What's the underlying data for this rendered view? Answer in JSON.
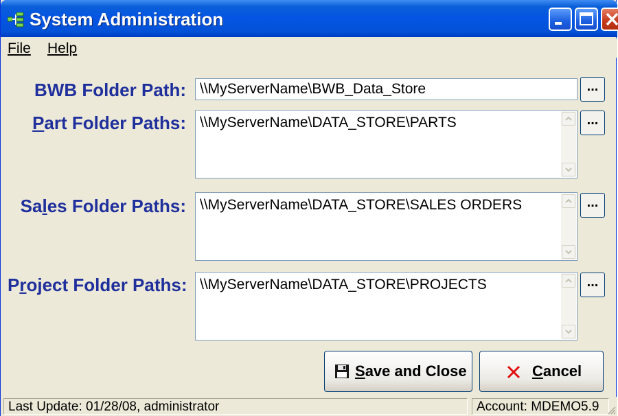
{
  "window": {
    "title": "System Administration"
  },
  "menu": {
    "file": "File",
    "help": "Help"
  },
  "fields": {
    "bwb": {
      "label_pre": "BWB Folder Path:",
      "value": "\\\\MyServerName\\BWB_Data_Store"
    },
    "part": {
      "label_ul": "P",
      "label_rest": "art Folder Paths:",
      "value": "\\\\MyServerName\\DATA_STORE\\PARTS"
    },
    "sales": {
      "label_a": "Sa",
      "label_ul": "l",
      "label_b": "es Folder Paths:",
      "value": "\\\\MyServerName\\DATA_STORE\\SALES ORDERS"
    },
    "project": {
      "label_a": "P",
      "label_ul": "r",
      "label_b": "oject Folder Paths:",
      "value": "\\\\MyServerName\\DATA_STORE\\PROJECTS"
    }
  },
  "browse_label": "...",
  "buttons": {
    "save": {
      "ul": "S",
      "rest": "ave and Close"
    },
    "cancel": {
      "ul": "C",
      "rest": "ancel"
    }
  },
  "status": {
    "last_update": "Last Update:  01/28/08, administrator",
    "account": "Account: MDEMO5.9"
  },
  "icons": {
    "app": "app-tree-icon",
    "save": "floppy-disk-icon",
    "cancel": "red-x-icon"
  }
}
